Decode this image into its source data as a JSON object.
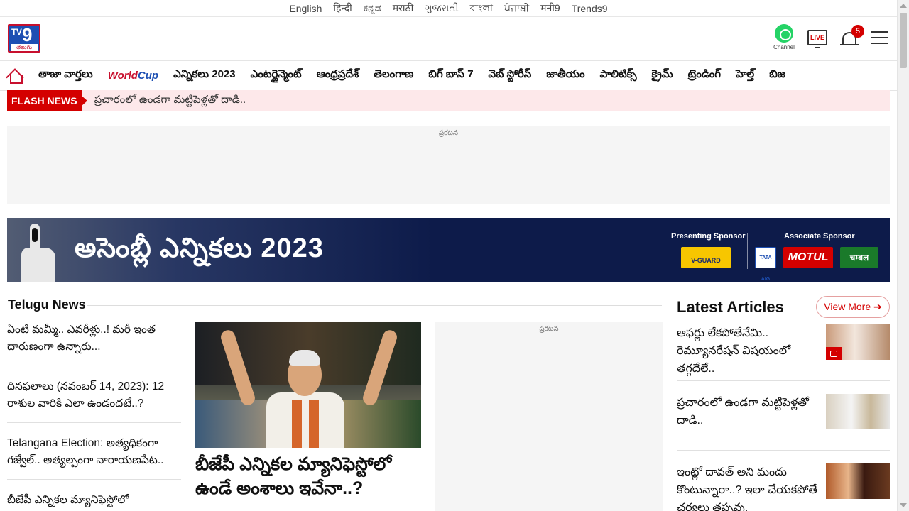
{
  "languages": [
    "English",
    "हिन्दी",
    "ಕನ್ನಡ",
    "मराठी",
    "ગુજરાતી",
    "বাংলা",
    "ਪੰਜਾਬੀ",
    "मनी9",
    "Trends9"
  ],
  "logo": {
    "tv": "TV",
    "nine": "9",
    "sub": "తెలుగు"
  },
  "header": {
    "whatsapp_label": "Channel",
    "live_label": "LIVE",
    "notification_count": "5"
  },
  "nav": {
    "items": [
      "తాజా వార్తలు",
      "ఎన్నికలు 2023",
      "ఎంటర్టైన్మెంట్",
      "ఆంధ్రప్రదేశ్",
      "తెలంగాణ",
      "బిగ్ బాస్ 7",
      "వెబ్ స్టోరీస్",
      "జాతీయం",
      "పాలిటిక్స్",
      "క్రైమ్",
      "ట్రెండింగ్",
      "హెల్త్",
      "బిజ"
    ],
    "worldcup_a": "World",
    "worldcup_b": "Cup"
  },
  "flash": {
    "tag": "FLASH NEWS",
    "text": "ప్రచారంలో ఉండగా మట్టిపెళ్లతో దాడి.."
  },
  "ad_label": "ప్రకటన",
  "banner": {
    "title": "అసెంబ్లీ ఎన్నికలు 2023",
    "presenting": "Presenting Sponsor",
    "associate": "Associate Sponsor",
    "sponsors": [
      "V-GUARD",
      "TATA AIG",
      "MOTUL",
      "चम्बल"
    ]
  },
  "telugu_news": {
    "title": "Telugu News",
    "items": [
      "ఏంటి మమ్మీ.. ఎవరీళ్లు..! మరీ ఇంత దారుణంగా ఉన్నారు...",
      "దినఫలాలు (నవంబర్ 14, 2023): 12 రాశుల వారికి ఎలా ఉండందటే..?",
      "Telangana Election: అత్యధికంగా గజ్వేల్.. అత్యల్పంగా నారాయణపేట..",
      "బీజేపీ ఎన్నికల మ్యానిఫెస్టోలో"
    ],
    "feature_headline": "బీజేపీ ఎన్నికల మ్యానిఫెస్టోలో ఉండే అంశాలు ఇవేనా..?"
  },
  "latest": {
    "title": "Latest Articles",
    "view_more": "View More ➔",
    "articles": [
      "ఆఫర్లు లేకపోతేనేమి.. రెమ్యూనరేషన్ విషయంలో తగ్గదేలే..",
      "ప్రచారంలో ఉండగా మట్టిపెళ్లతో దాడి..",
      "ఇంట్లో దావత్ అని మందు కొంటున్నారా..? ఇలా చేయకపోతే చర్యలు తప్పవు."
    ]
  },
  "colors": {
    "brand_red": "#d40000",
    "banner_navy": "#0d1b4a",
    "flash_bg": "#fde8ea"
  }
}
